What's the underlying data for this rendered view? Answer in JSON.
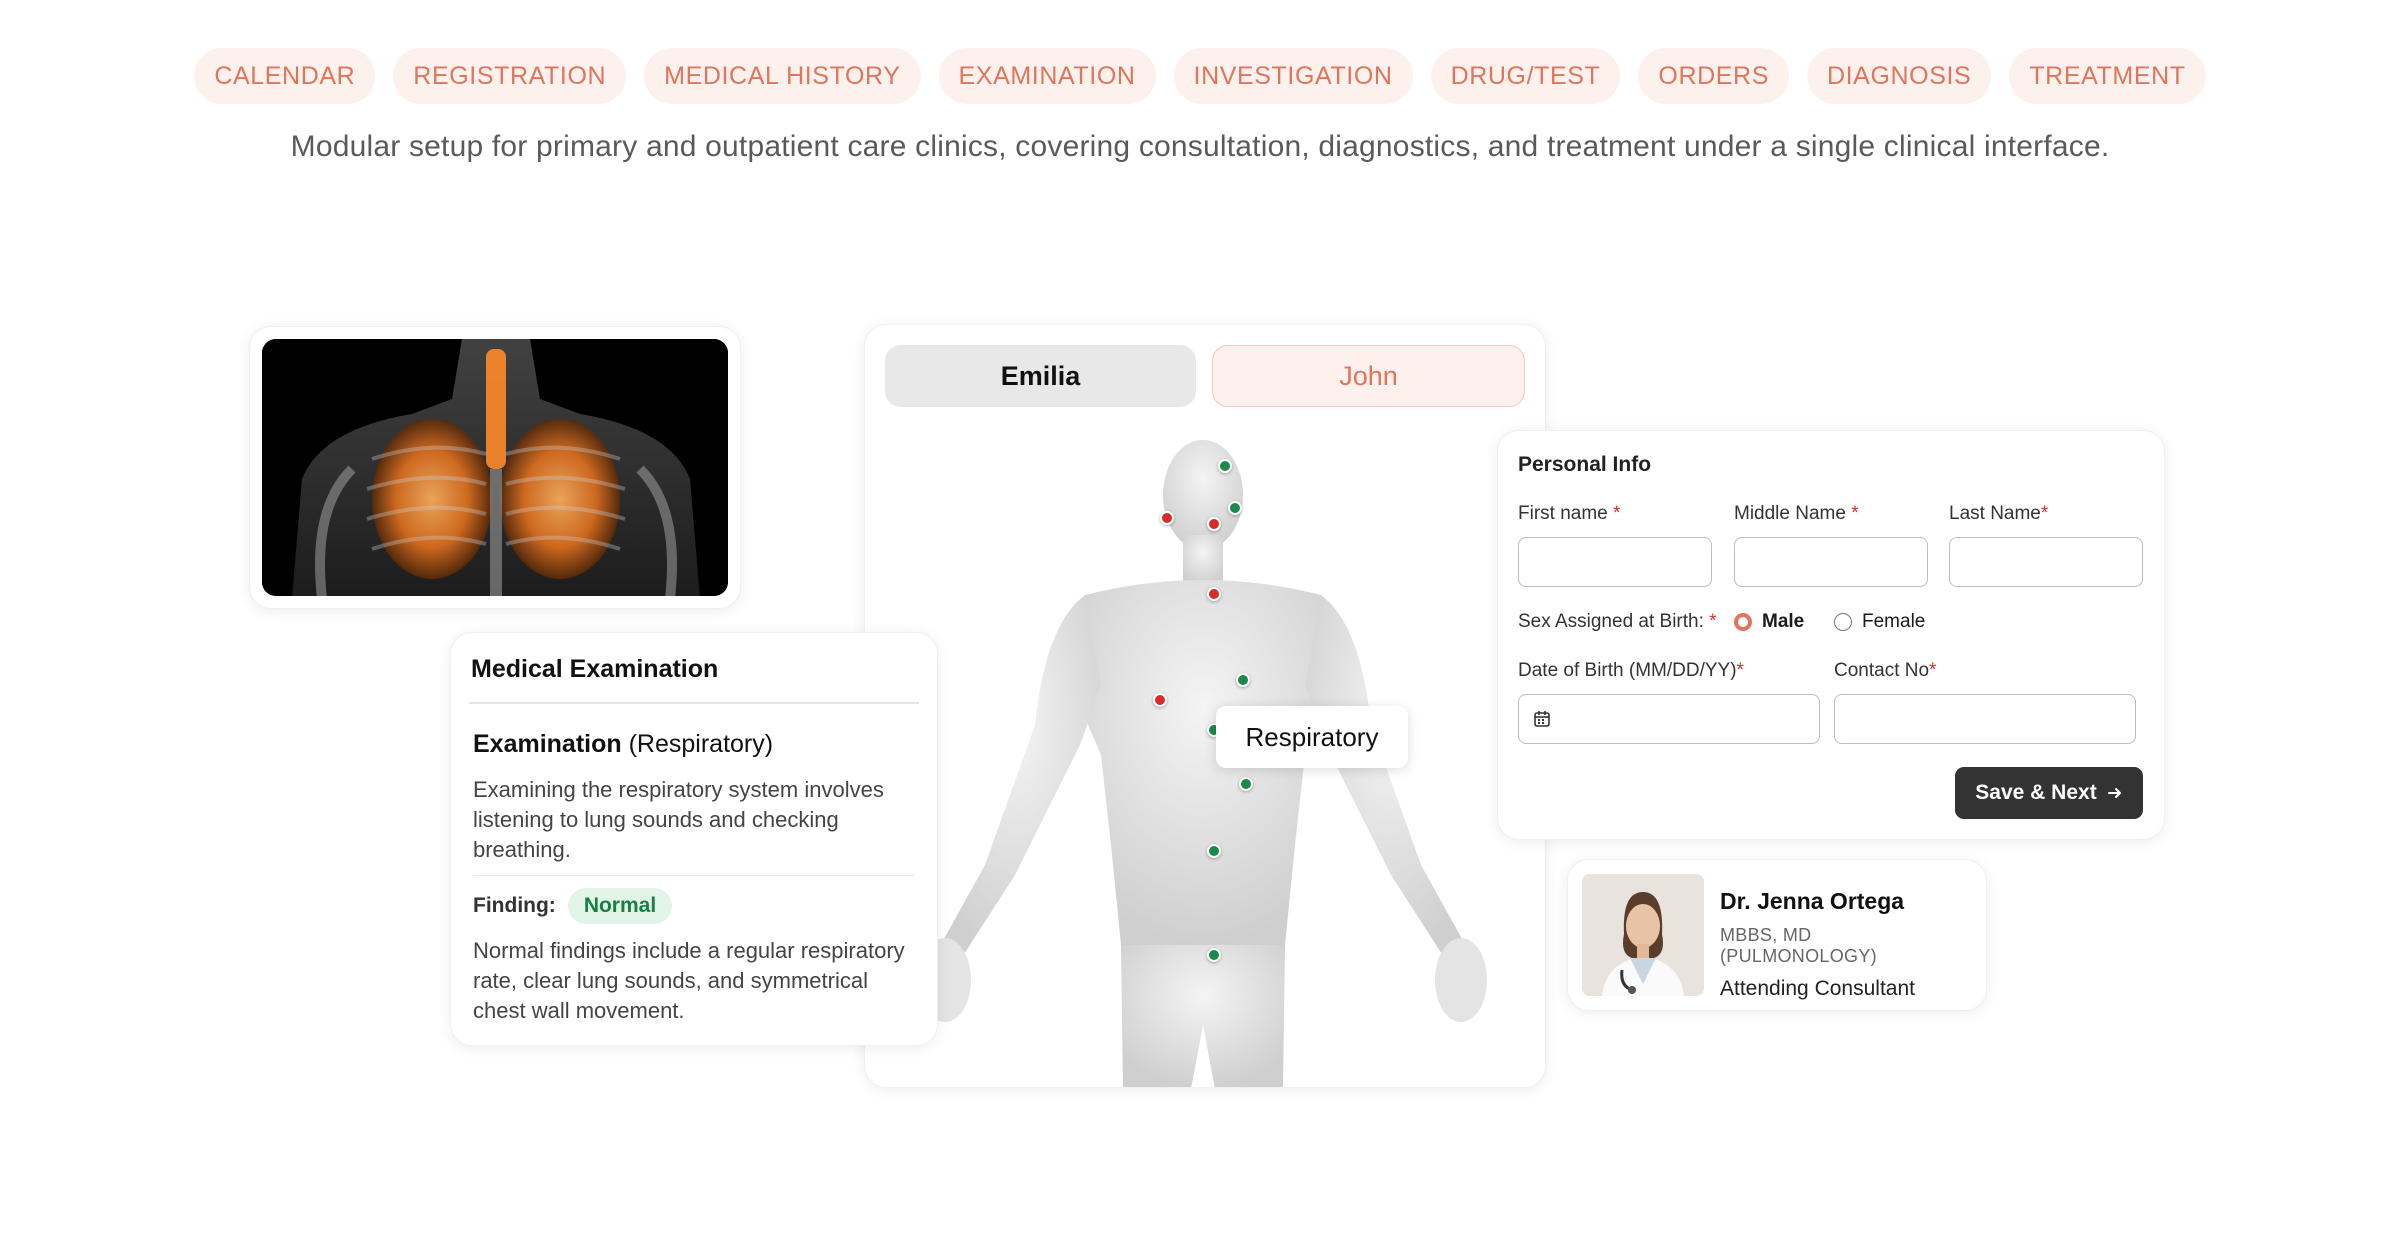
{
  "tabs": [
    "CALENDAR",
    "REGISTRATION",
    "MEDICAL HISTORY",
    "EXAMINATION",
    "INVESTIGATION",
    "DRUG/TEST",
    "ORDERS",
    "DIAGNOSIS",
    "TREATMENT"
  ],
  "subtitle": "Modular setup for primary and outpatient care clinics, covering consultation, diagnostics, and treatment under a single clinical interface.",
  "patients": {
    "a": "Emilia",
    "b": "John"
  },
  "body_label": "Respiratory",
  "exam": {
    "title": "Medical Examination",
    "heading_bold": "Examination",
    "heading_rest": "(Respiratory)",
    "description": "Examining the respiratory system involves listening to lung sounds and checking breathing.",
    "finding_label": "Finding:",
    "finding_value": "Normal",
    "finding_text": "Normal findings include a regular respiratory rate, clear lung sounds, and symmetrical chest wall movement."
  },
  "form": {
    "title": "Personal Info",
    "first_name": "First name",
    "middle_name": "Middle Name",
    "last_name": "Last Name",
    "sex_label": "Sex Assigned at Birth:",
    "male": "Male",
    "female": "Female",
    "dob": "Date of Birth (MM/DD/YY)",
    "contact": "Contact No",
    "req": "*",
    "save": "Save & Next"
  },
  "doctor": {
    "name": "Dr. Jenna Ortega",
    "degree": "MBBS, MD (PULMONOLOGY)",
    "role": "Attending Consultant"
  },
  "colors": {
    "accent": "#e0755c",
    "green": "#1a8a4a",
    "red": "#d92b2b"
  },
  "icons": {
    "calendar": "calendar-icon",
    "arrow": "arrow-right-icon"
  }
}
